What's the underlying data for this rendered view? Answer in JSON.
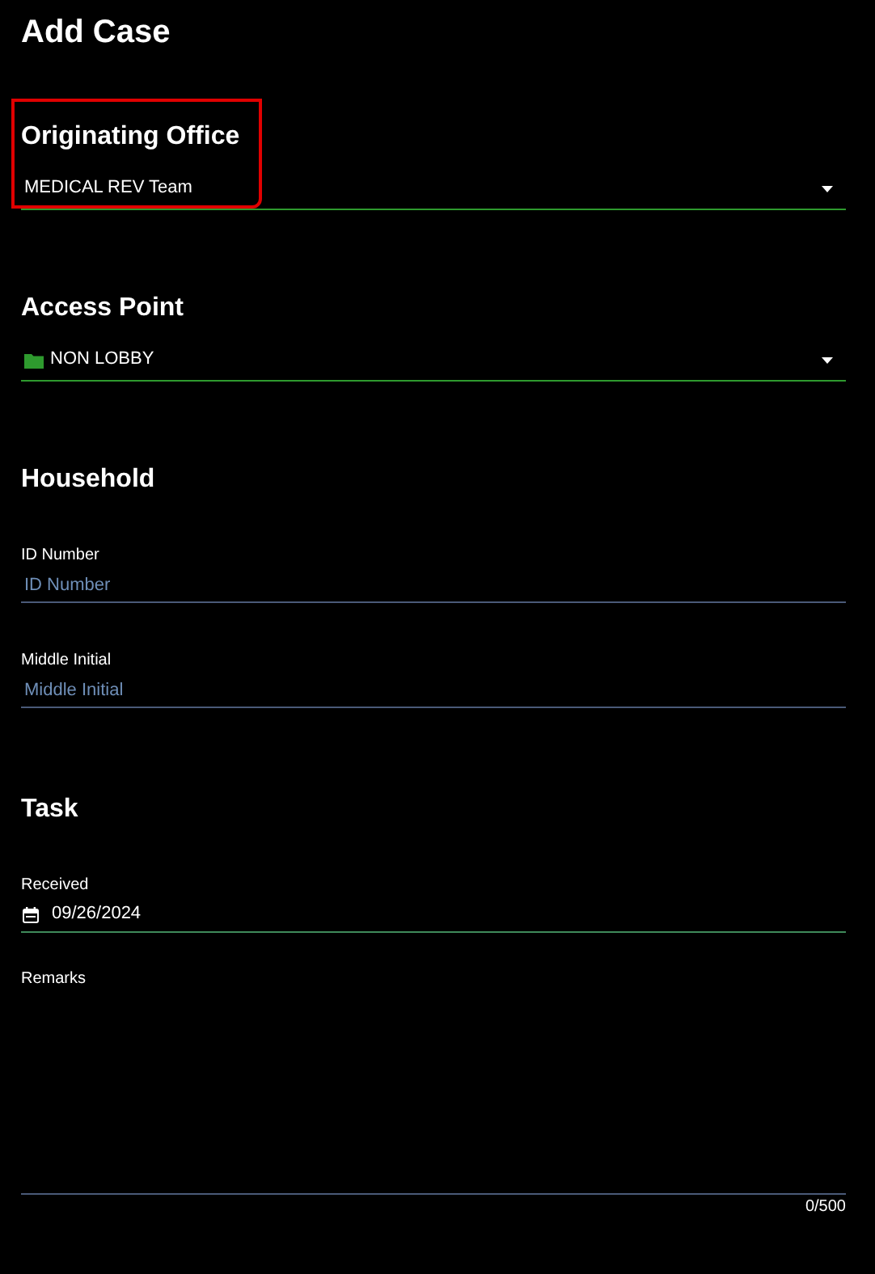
{
  "title": "Add Case",
  "highlight_annotation": true,
  "sections": [
    {
      "heading": "Originating Office",
      "fields": [
        {
          "kind": "select",
          "value": "MEDICAL REV Team",
          "folder_icon": false
        }
      ]
    },
    {
      "heading": "Access Point",
      "fields": [
        {
          "kind": "select",
          "value": "NON LOBBY",
          "folder_icon": true
        }
      ]
    },
    {
      "heading": "Household",
      "fields": [
        {
          "kind": "text",
          "label": "ID Number",
          "placeholder": "ID Number"
        },
        {
          "kind": "text",
          "label": "Middle Initial",
          "placeholder": "Middle Initial"
        }
      ]
    },
    {
      "heading": "Task",
      "fields": [
        {
          "kind": "date",
          "label": "Received",
          "value": "09/26/2024"
        },
        {
          "kind": "textarea",
          "label": "Remarks",
          "counter": "0/500"
        }
      ]
    }
  ]
}
